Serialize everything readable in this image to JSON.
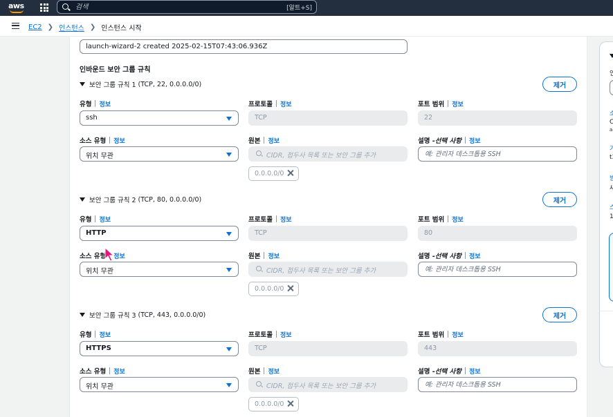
{
  "topbar": {
    "logo": "aws",
    "search_placeholder": "검색",
    "search_shortcut": "[알트+S]"
  },
  "breadcrumb": {
    "items": [
      "EC2",
      "인스턴스"
    ],
    "current": "인스턴스 시작"
  },
  "security_group_description": "launch-wizard-2 created 2025-02-15T07:43:06.936Z",
  "section_title": "인바운드 보안 그룹 규칙",
  "labels": {
    "type": "유형",
    "protocol": "프로토콜",
    "port_range": "포트 범위",
    "source_type": "소스 유형",
    "source": "원본",
    "description": "설명 - ",
    "description_optional": "선택 사항",
    "info": "정보",
    "remove": "제거",
    "cidr_placeholder": "CIDR, 접두사 목록 또는 보안 그룹 추가"
  },
  "rules": [
    {
      "title": "보안 그룹 규칙 1",
      "meta": "(TCP, 22, 0.0.0.0/0)",
      "type": "ssh",
      "protocol": "TCP",
      "port": "22",
      "source_type": "위치 무관",
      "source_token": "0.0.0.0/0",
      "description_placeholder": "예: 관리자 데스크톱용 SSH"
    },
    {
      "title": "보안 그룹 규칙 2",
      "meta": "(TCP, 80, 0.0.0.0/0)",
      "type": "HTTP",
      "protocol": "TCP",
      "port": "80",
      "source_type": "위치 무관",
      "source_token": "0.0.0.0/0",
      "description_placeholder": "예: 관리자 데스크톱용 SSH"
    },
    {
      "title": "보안 그룹 규칙 3",
      "meta": "(TCP, 443, 0.0.0.0/0)",
      "type": "HTTPS",
      "protocol": "TCP",
      "port": "443",
      "source_type": "위치 무관",
      "source_token": "0.0.0.0/0",
      "description_placeholder": "예: 관리자 데스크톱용 SSH"
    }
  ],
  "side_panel": {
    "fragments": [
      "인",
      "소",
      "C",
      "a",
      "기",
      "t3",
      "방",
      "새",
      "스",
      "1"
    ]
  },
  "colors": {
    "nav": "#232f3e",
    "link": "#0972d3",
    "logo_accent": "#ff9900",
    "cursor": "#e7157b"
  }
}
